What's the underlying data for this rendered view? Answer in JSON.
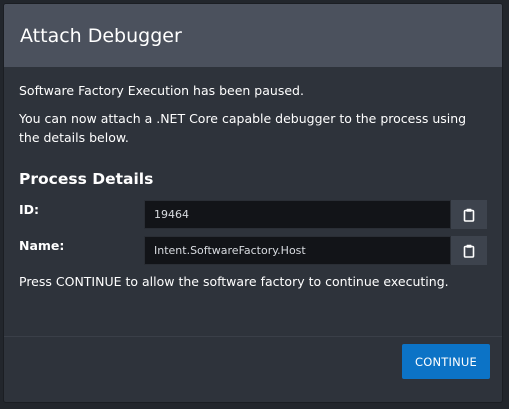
{
  "dialog": {
    "title": "Attach Debugger",
    "message_paused": "Software Factory Execution has been paused.",
    "message_attach": "You can now attach a .NET Core capable debugger to the process using the details below.",
    "section_title": "Process Details",
    "fields": [
      {
        "label": "ID:",
        "value": "19464"
      },
      {
        "label": "Name:",
        "value": "Intent.SoftwareFactory.Host"
      }
    ],
    "footer_note": "Press CONTINUE to allow the software factory to continue executing.",
    "continue_label": "CONTINUE"
  },
  "colors": {
    "accent": "#0c73c6",
    "header": "#4b515d",
    "panel": "#2e333b"
  },
  "icons": {
    "copy": "clipboard-icon"
  }
}
